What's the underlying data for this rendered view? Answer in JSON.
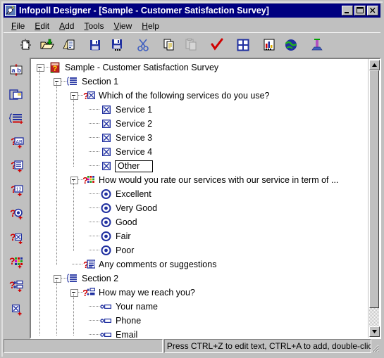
{
  "window": {
    "title": "Infopoll Designer - [Sample - Customer Satisfaction Survey]",
    "app_icon": "satellite-dish-icon",
    "buttons": [
      {
        "name": "minimize-button",
        "glyph": "minimize"
      },
      {
        "name": "maximize-button",
        "glyph": "maximize"
      },
      {
        "name": "close-button",
        "glyph": "close"
      }
    ],
    "titlebar_color": "#000080",
    "face_color": "#c0c0c0"
  },
  "menubar": {
    "items": [
      {
        "label": "File",
        "accel": "F"
      },
      {
        "label": "Edit",
        "accel": "E"
      },
      {
        "label": "Add",
        "accel": "A"
      },
      {
        "label": "Tools",
        "accel": "T"
      },
      {
        "label": "View",
        "accel": "V"
      },
      {
        "label": "Help",
        "accel": "H"
      }
    ]
  },
  "toolbar": {
    "buttons": [
      {
        "name": "new-survey-button",
        "icon": "new-document-icon",
        "enabled": true
      },
      {
        "name": "open-button",
        "icon": "open-folder-icon",
        "enabled": true
      },
      {
        "name": "new-from-template-button",
        "icon": "document-stack-icon",
        "enabled": true
      },
      {
        "name": "save-button",
        "icon": "floppy-disk-icon",
        "enabled": true
      },
      {
        "name": "save-as-button",
        "icon": "floppy-disk-ellipsis-icon",
        "enabled": true
      },
      {
        "name": "cut-button",
        "icon": "scissors-icon",
        "enabled": true
      },
      {
        "name": "copy-button",
        "icon": "copy-pages-icon",
        "enabled": true
      },
      {
        "name": "paste-button",
        "icon": "clipboard-paste-icon",
        "enabled": false
      },
      {
        "name": "validate-button",
        "icon": "red-check-icon",
        "enabled": true
      },
      {
        "name": "layout-grid-button",
        "icon": "grid-four-pane-icon",
        "enabled": true
      },
      {
        "name": "report-chart-button",
        "icon": "bar-chart-icon",
        "enabled": true
      },
      {
        "name": "publish-web-button",
        "icon": "globe-icon",
        "enabled": true
      },
      {
        "name": "exit-button",
        "icon": "exit-door-icon",
        "enabled": true
      }
    ]
  },
  "sidebar": {
    "buttons": [
      {
        "name": "add-text-label-button",
        "icon": "ab-text-icon"
      },
      {
        "name": "add-page-button",
        "icon": "page-copy-icon"
      },
      {
        "name": "add-section-button",
        "icon": "section-lines-icon"
      },
      {
        "name": "add-text-question-button",
        "icon": "question-ab-icon"
      },
      {
        "name": "add-paragraph-question-button",
        "icon": "question-paragraph-icon"
      },
      {
        "name": "add-numeric-question-button",
        "icon": "question-12-icon"
      },
      {
        "name": "add-radio-question-button",
        "icon": "question-radio-icon"
      },
      {
        "name": "add-checkbox-question-button",
        "icon": "question-checkbox-icon"
      },
      {
        "name": "add-matrix-question-button",
        "icon": "question-matrix-icon"
      },
      {
        "name": "add-form-question-button",
        "icon": "question-form-icon"
      },
      {
        "name": "add-choice-item-button",
        "icon": "checkbox-plus-icon"
      }
    ]
  },
  "tree": {
    "rows": [
      {
        "depth": 0,
        "expander": "minus",
        "icon": "survey-root-icon",
        "label": "Sample - Customer Satisfaction Survey",
        "name": "tree-node-survey-root",
        "boxed": false
      },
      {
        "depth": 1,
        "expander": "minus",
        "icon": "section-icon",
        "label": "Section 1",
        "name": "tree-node-section-1",
        "boxed": false
      },
      {
        "depth": 2,
        "expander": "minus",
        "icon": "question-checkbox-icon",
        "label": "Which of the following services do you use?",
        "name": "tree-node-question-services",
        "boxed": false
      },
      {
        "depth": 3,
        "expander": "none",
        "icon": "checkbox-icon",
        "label": "Service 1",
        "name": "tree-node-choice-service-1",
        "boxed": false
      },
      {
        "depth": 3,
        "expander": "none",
        "icon": "checkbox-icon",
        "label": "Service 2",
        "name": "tree-node-choice-service-2",
        "boxed": false
      },
      {
        "depth": 3,
        "expander": "none",
        "icon": "checkbox-icon",
        "label": "Service 3",
        "name": "tree-node-choice-service-3",
        "boxed": false
      },
      {
        "depth": 3,
        "expander": "none",
        "icon": "checkbox-icon",
        "label": "Service 4",
        "name": "tree-node-choice-service-4",
        "boxed": false
      },
      {
        "depth": 3,
        "expander": "none",
        "icon": "checkbox-icon",
        "label": "Other",
        "name": "tree-node-choice-other-edit",
        "boxed": true
      },
      {
        "depth": 2,
        "expander": "minus",
        "icon": "question-matrix-icon",
        "label": "How would you rate our services with our service in term of ...",
        "name": "tree-node-question-rating",
        "boxed": false
      },
      {
        "depth": 3,
        "expander": "none",
        "icon": "radio-icon",
        "label": "Excellent",
        "name": "tree-node-choice-excellent",
        "boxed": false
      },
      {
        "depth": 3,
        "expander": "none",
        "icon": "radio-icon",
        "label": "Very Good",
        "name": "tree-node-choice-very-good",
        "boxed": false
      },
      {
        "depth": 3,
        "expander": "none",
        "icon": "radio-icon",
        "label": "Good",
        "name": "tree-node-choice-good",
        "boxed": false
      },
      {
        "depth": 3,
        "expander": "none",
        "icon": "radio-icon",
        "label": "Fair",
        "name": "tree-node-choice-fair",
        "boxed": false
      },
      {
        "depth": 3,
        "expander": "none",
        "icon": "radio-icon",
        "label": "Poor",
        "name": "tree-node-choice-poor",
        "boxed": false
      },
      {
        "depth": 2,
        "expander": "none",
        "icon": "question-paragraph-icon",
        "label": "Any comments or suggestions",
        "name": "tree-node-question-comments",
        "boxed": false
      },
      {
        "depth": 1,
        "expander": "minus",
        "icon": "section-icon",
        "label": "Section 2",
        "name": "tree-node-section-2",
        "boxed": false
      },
      {
        "depth": 2,
        "expander": "minus",
        "icon": "question-form-icon",
        "label": "How may we reach you?",
        "name": "tree-node-question-contact",
        "boxed": false
      },
      {
        "depth": 3,
        "expander": "none",
        "icon": "textfield-icon",
        "label": "Your name",
        "name": "tree-node-field-your-name",
        "boxed": false
      },
      {
        "depth": 3,
        "expander": "none",
        "icon": "textfield-icon",
        "label": "Phone",
        "name": "tree-node-field-phone",
        "boxed": false
      },
      {
        "depth": 3,
        "expander": "none",
        "icon": "textfield-icon",
        "label": "Email",
        "name": "tree-node-field-email",
        "boxed": false
      }
    ]
  },
  "scrollbar": {
    "up_arrow": "scroll-up-arrow",
    "down_arrow": "scroll-down-arrow",
    "thumb": "scroll-thumb"
  },
  "statusbar": {
    "left_pane": "",
    "message": "Press CTRL+Z to edit text, CTRL+A to add, double-click to edit item prc"
  }
}
